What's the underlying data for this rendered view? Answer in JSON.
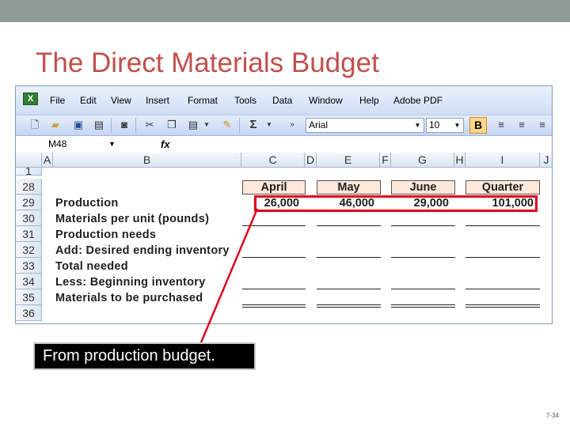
{
  "slide": {
    "title": "The Direct Materials Budget",
    "callout": "From production budget.",
    "page_number": "7-34"
  },
  "menu": [
    "File",
    "Edit",
    "View",
    "Insert",
    "Format",
    "Tools",
    "Data",
    "Window",
    "Help",
    "Adobe PDF"
  ],
  "toolbar": {
    "font_name": "Arial",
    "font_size": "10",
    "bold_label": "B",
    "sum_label": "Σ"
  },
  "formula_bar": {
    "cell_ref": "M48",
    "fx_label": "fx",
    "value": ""
  },
  "columns": [
    "A",
    "B",
    "C",
    "D",
    "E",
    "F",
    "G",
    "H",
    "I",
    "J"
  ],
  "rows": [
    "1",
    "28",
    "29",
    "30",
    "31",
    "32",
    "33",
    "34",
    "35",
    "36"
  ],
  "budget": {
    "headers": [
      "April",
      "May",
      "June",
      "Quarter"
    ],
    "labels": [
      "Production",
      "Materials per unit (pounds)",
      "Production needs",
      "Add: Desired ending inventory",
      "Total needed",
      "Less: Beginning inventory",
      "Materials to be purchased"
    ],
    "production": [
      "26,000",
      "46,000",
      "29,000",
      "101,000"
    ]
  }
}
